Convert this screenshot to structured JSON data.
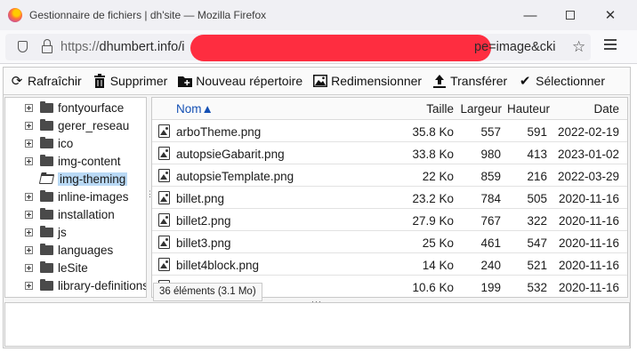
{
  "window": {
    "title": "Gestionnaire de fichiers | dh'site — Mozilla Firefox",
    "minimize": "—",
    "close": "✕"
  },
  "urlbar": {
    "prefix": "https://",
    "host": "dhumbert.info/i",
    "tail": "pe=image&cki",
    "star": "☆"
  },
  "toolbar": {
    "refresh": {
      "label": "Rafraîchir",
      "icon": "refresh-icon",
      "glyph": "⟳"
    },
    "delete": {
      "label": "Supprimer",
      "icon": "trash-icon",
      "glyph": "🗑"
    },
    "new_folder": {
      "label": "Nouveau répertoire",
      "icon": "new-folder-icon",
      "glyph": "▰"
    },
    "resize": {
      "label": "Redimensionner",
      "icon": "image-icon",
      "glyph": "▨"
    },
    "upload": {
      "label": "Transférer",
      "icon": "upload-icon",
      "glyph": "⤒"
    },
    "select": {
      "label": "Sélectionner",
      "icon": "check-icon",
      "glyph": "✔"
    }
  },
  "tree": {
    "items": [
      {
        "label": "fontyourface",
        "expandable": true,
        "selected": false
      },
      {
        "label": "gerer_reseau",
        "expandable": true,
        "selected": false
      },
      {
        "label": "ico",
        "expandable": true,
        "selected": false
      },
      {
        "label": "img-content",
        "expandable": true,
        "selected": false
      },
      {
        "label": "img-theming",
        "expandable": false,
        "selected": true
      },
      {
        "label": "inline-images",
        "expandable": true,
        "selected": false
      },
      {
        "label": "installation",
        "expandable": true,
        "selected": false
      },
      {
        "label": "js",
        "expandable": true,
        "selected": false
      },
      {
        "label": "languages",
        "expandable": true,
        "selected": false
      },
      {
        "label": "leSite",
        "expandable": true,
        "selected": false
      },
      {
        "label": "library-definitions",
        "expandable": true,
        "selected": false
      }
    ]
  },
  "filelist": {
    "headers": {
      "name": "Nom▲",
      "size": "Taille",
      "width": "Largeur",
      "height": "Hauteur",
      "date": "Date"
    },
    "rows": [
      {
        "name": "arboTheme.png",
        "size": "35.8 Ko",
        "width": "557",
        "height": "591",
        "date": "2022-02-19"
      },
      {
        "name": "autopsieGabarit.png",
        "size": "33.8 Ko",
        "width": "980",
        "height": "413",
        "date": "2023-01-02"
      },
      {
        "name": "autopsieTemplate.png",
        "size": "22 Ko",
        "width": "859",
        "height": "216",
        "date": "2022-03-29"
      },
      {
        "name": "billet.png",
        "size": "23.2 Ko",
        "width": "784",
        "height": "505",
        "date": "2020-11-16"
      },
      {
        "name": "billet2.png",
        "size": "27.9 Ko",
        "width": "767",
        "height": "322",
        "date": "2020-11-16"
      },
      {
        "name": "billet3.png",
        "size": "25 Ko",
        "width": "461",
        "height": "547",
        "date": "2020-11-16"
      },
      {
        "name": "billet4block.png",
        "size": "14 Ko",
        "width": "240",
        "height": "521",
        "date": "2020-11-16"
      },
      {
        "name": "bpng",
        "size": "10.6 Ko",
        "width": "199",
        "height": "532",
        "date": "2020-11-16"
      }
    ]
  },
  "status": {
    "count": "36 éléments (3.1 Mo)"
  },
  "colors": {
    "accent": "#1450b4",
    "selection": "#b9d9f5",
    "redaction": "#fe2d40"
  }
}
